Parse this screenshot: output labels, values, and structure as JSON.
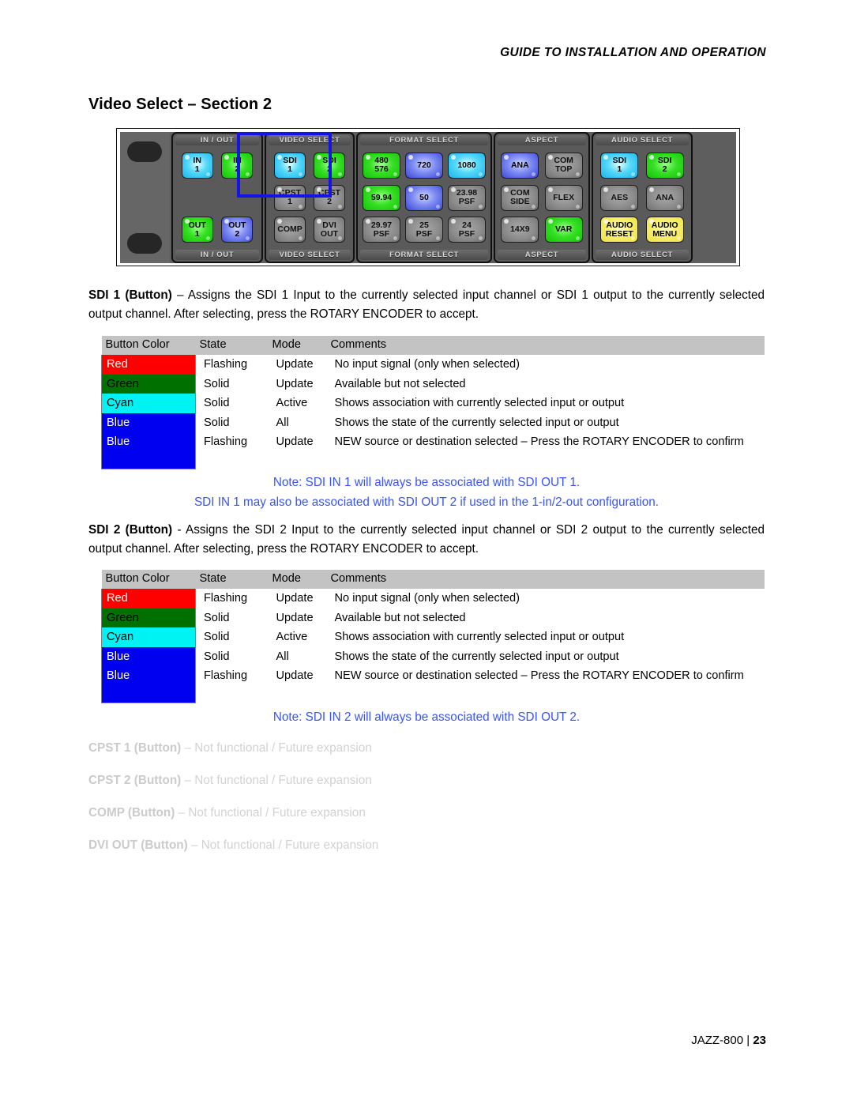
{
  "header": {
    "running_head": "GUIDE TO INSTALLATION AND OPERATION"
  },
  "section": {
    "title": "Video Select – Section 2"
  },
  "control_panel": {
    "groups": [
      {
        "name": "in-out",
        "label_top": "IN / OUT",
        "label_bottom": "IN / OUT",
        "buttons": [
          [
            {
              "line1": "IN",
              "line2": "1",
              "color": "cyan"
            },
            {
              "line1": "IN",
              "line2": "2",
              "color": "green"
            }
          ],
          [
            {
              "line1": "",
              "line2": "",
              "color": "blank"
            },
            {
              "line1": "",
              "line2": "",
              "color": "blank"
            }
          ],
          [
            {
              "line1": "OUT",
              "line2": "1",
              "color": "green"
            },
            {
              "line1": "OUT",
              "line2": "2",
              "color": "blue"
            }
          ]
        ]
      },
      {
        "name": "video-select",
        "label_top": "VIDEO SELECT",
        "label_bottom": "VIDEO SELECT",
        "buttons": [
          [
            {
              "line1": "SDI",
              "line2": "1",
              "color": "cyan"
            },
            {
              "line1": "SDI",
              "line2": "2",
              "color": "green"
            }
          ],
          [
            {
              "line1": "CPST",
              "line2": "1",
              "color": "grey"
            },
            {
              "line1": "CPST",
              "line2": "2",
              "color": "grey"
            }
          ],
          [
            {
              "line1": "COMP",
              "line2": "",
              "color": "grey"
            },
            {
              "line1": "DVI",
              "line2": "OUT",
              "color": "grey"
            }
          ]
        ]
      },
      {
        "name": "format-select",
        "label_top": "FORMAT SELECT",
        "label_bottom": "FORMAT SELECT",
        "buttons": [
          [
            {
              "line1": "480",
              "line2": "576",
              "color": "green"
            },
            {
              "line1": "720",
              "line2": "",
              "color": "blue"
            },
            {
              "line1": "1080",
              "line2": "",
              "color": "cyan"
            }
          ],
          [
            {
              "line1": "59.94",
              "line2": "",
              "color": "green"
            },
            {
              "line1": "50",
              "line2": "",
              "color": "blue"
            },
            {
              "line1": "23.98",
              "line2": "PSF",
              "color": "grey"
            }
          ],
          [
            {
              "line1": "29.97",
              "line2": "PSF",
              "color": "grey"
            },
            {
              "line1": "25",
              "line2": "PSF",
              "color": "grey"
            },
            {
              "line1": "24",
              "line2": "PSF",
              "color": "grey"
            }
          ]
        ]
      },
      {
        "name": "aspect",
        "label_top": "ASPECT",
        "label_bottom": "ASPECT",
        "buttons": [
          [
            {
              "line1": "ANA",
              "line2": "",
              "color": "blue"
            },
            {
              "line1": "COM",
              "line2": "TOP",
              "color": "grey"
            }
          ],
          [
            {
              "line1": "COM",
              "line2": "SIDE",
              "color": "grey"
            },
            {
              "line1": "FLEX",
              "line2": "",
              "color": "grey"
            }
          ],
          [
            {
              "line1": "14X9",
              "line2": "",
              "color": "grey"
            },
            {
              "line1": "VAR",
              "line2": "",
              "color": "green"
            }
          ]
        ]
      },
      {
        "name": "audio-select",
        "label_top": "AUDIO SELECT",
        "label_bottom": "AUDIO SELECT",
        "buttons": [
          [
            {
              "line1": "SDI",
              "line2": "1",
              "color": "cyan"
            },
            {
              "line1": "SDI",
              "line2": "2",
              "color": "green"
            }
          ],
          [
            {
              "line1": "AES",
              "line2": "",
              "color": "grey"
            },
            {
              "line1": "ANA",
              "line2": "",
              "color": "grey"
            }
          ],
          [
            {
              "line1": "AUDIO",
              "line2": "RESET",
              "color": "yellow"
            },
            {
              "line1": "AUDIO",
              "line2": "MENU",
              "color": "yellow"
            }
          ]
        ]
      }
    ],
    "selection_highlight": {
      "target": "VIDEO SELECT SDI 1 / SDI 2",
      "color": "#1414E6"
    }
  },
  "sdi1": {
    "label": "SDI 1 (Button)",
    "dash": " – ",
    "text": "Assigns the SDI 1 Input to the currently selected input channel or SDI 1 output to the currently selected output channel. After selecting, press the ROTARY ENCODER to accept."
  },
  "sdi2": {
    "label": "SDI 2 (Button)",
    "dash": " - ",
    "text": "Assigns the SDI 2 Input to the currently selected input channel or SDI 2 output to the currently selected output channel. After selecting, press the ROTARY ENCODER to accept."
  },
  "state_table": {
    "headers": [
      "Button Color",
      "State",
      "Mode",
      "Comments"
    ],
    "rows": [
      {
        "color": "Red",
        "swatch_hex": "#FF0000",
        "text_hex": "#FFFFFF",
        "state": "Flashing",
        "mode": "Update",
        "comment": "No input signal (only when selected)"
      },
      {
        "color": "Green",
        "swatch_hex": "#007000",
        "text_hex": "#000000",
        "state": "Solid",
        "mode": "Update",
        "comment": "Available but not selected"
      },
      {
        "color": "Cyan",
        "swatch_hex": "#00F3F3",
        "text_hex": "#000000",
        "state": "Solid",
        "mode": "Active",
        "comment": "Shows association with currently selected input or output"
      },
      {
        "color": "Blue",
        "swatch_hex": "#0000F0",
        "text_hex": "#FFFFFF",
        "state": "Solid",
        "mode": "All",
        "comment": "Shows the state of the currently selected input or output"
      },
      {
        "color": "Blue",
        "swatch_hex": "#0000F0",
        "text_hex": "#FFFFFF",
        "state": "Flashing",
        "mode": "Update",
        "comment": "NEW source or destination selected – Press the ROTARY ENCODER to confirm"
      }
    ]
  },
  "notes": {
    "note1_line1": "Note: SDI IN 1 will always be associated with SDI OUT 1.",
    "note1_line2": "SDI IN 1 may also be associated with SDI OUT 2 if used in the 1-in/2-out configuration.",
    "note2_line1": "Note: SDI IN 2 will always be associated with SDI OUT 2.",
    "color": "#3A55EF"
  },
  "future_expansion": [
    {
      "label": "CPST 1 (Button)",
      "text": " – Not functional / Future expansion"
    },
    {
      "label": "CPST 2 (Button)",
      "text": " – Not functional / Future expansion"
    },
    {
      "label": "COMP (Button)",
      "text": " – Not functional / Future expansion"
    },
    {
      "label": "DVI OUT (Button)",
      "text": " – Not functional / Future expansion"
    }
  ],
  "footer": {
    "model": "JAZZ-800",
    "separator": "|",
    "page": "23"
  }
}
